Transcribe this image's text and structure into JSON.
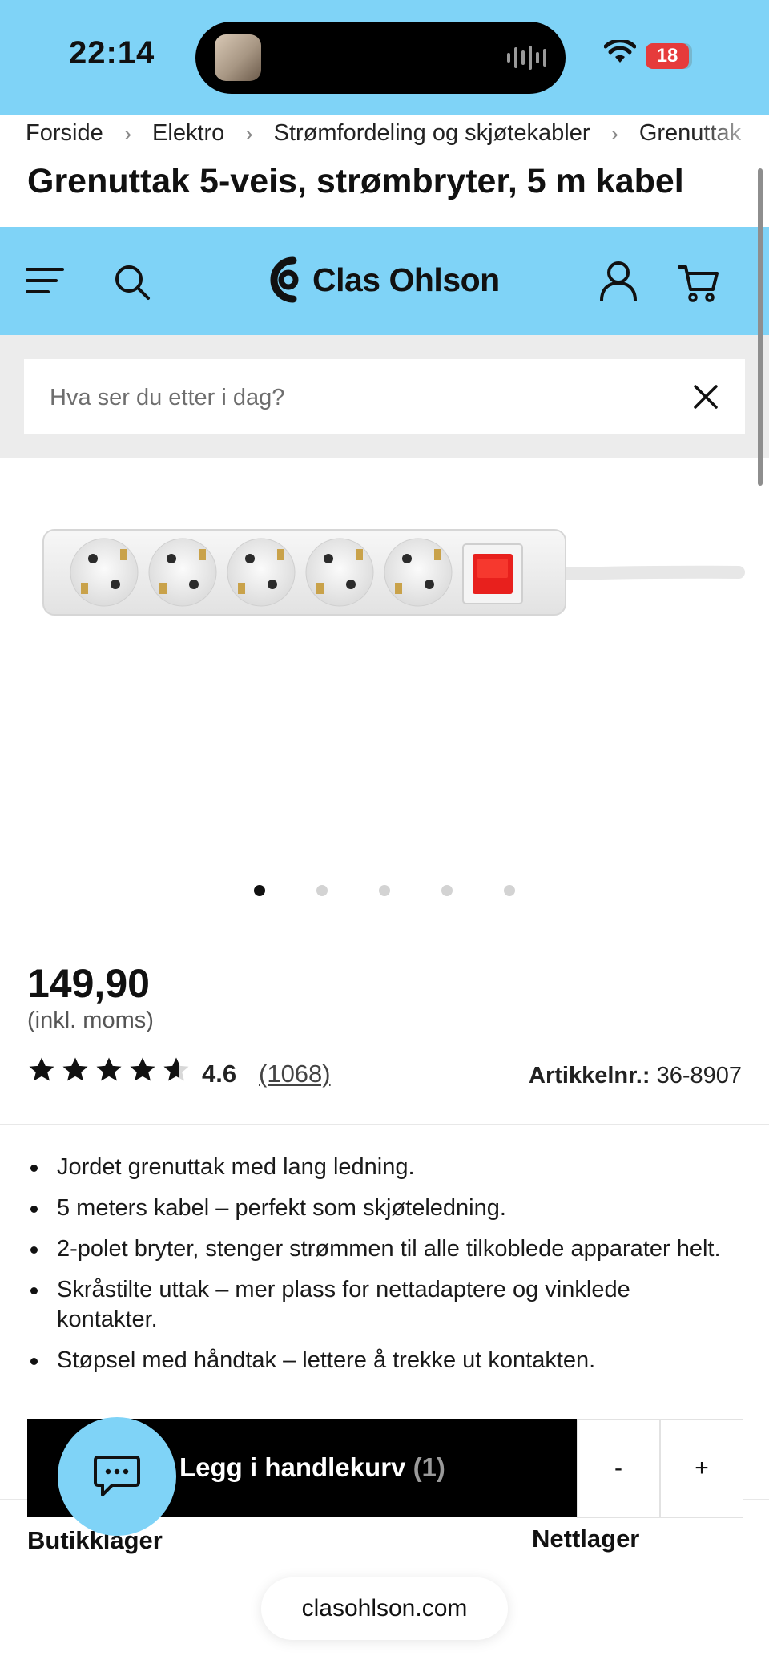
{
  "status_bar": {
    "time": "22:14",
    "battery": "18"
  },
  "breadcrumb": [
    "Forside",
    "Elektro",
    "Strømfordeling og skjøtekabler",
    "Grenuttak"
  ],
  "page_title": "Grenuttak 5-veis, strømbryter, 5 m kabel",
  "header": {
    "brand": "Clas Ohlson",
    "icons": [
      "menu-icon",
      "search-icon",
      "user-icon",
      "cart-icon"
    ]
  },
  "search": {
    "placeholder": "Hva ser du etter i dag?"
  },
  "gallery": {
    "image_count": 5,
    "active_index": 0
  },
  "product": {
    "price": "149,90",
    "price_note": "(inkl. moms)",
    "rating_value": "4.6",
    "rating": 4.6,
    "review_count": "(1068)",
    "article_label": "Artikkelnr.:",
    "article_number": "36-8907",
    "features": [
      "Jordet grenuttak med lang ledning.",
      "5 meters kabel – perfekt som skjøteledning.",
      "2-polet bryter, stenger strømmen til alle tilkoblede apparater helt.",
      "Skråstilte uttak – mer plass for nettadaptere og vinklede kontakter.",
      "Støpsel med håndtak – lettere å trekke ut kontakten."
    ]
  },
  "cart_bar": {
    "label": "Legg i handlekurv",
    "count": "(1)",
    "minus": "-",
    "plus": "+"
  },
  "stock": {
    "store": "Butikklager",
    "online": "Nettlager"
  },
  "browser": {
    "domain": "clasohlson.com"
  },
  "colors": {
    "brand_blue": "#7fd3f7",
    "cta_black": "#000000",
    "switch_red": "#e8201d"
  }
}
